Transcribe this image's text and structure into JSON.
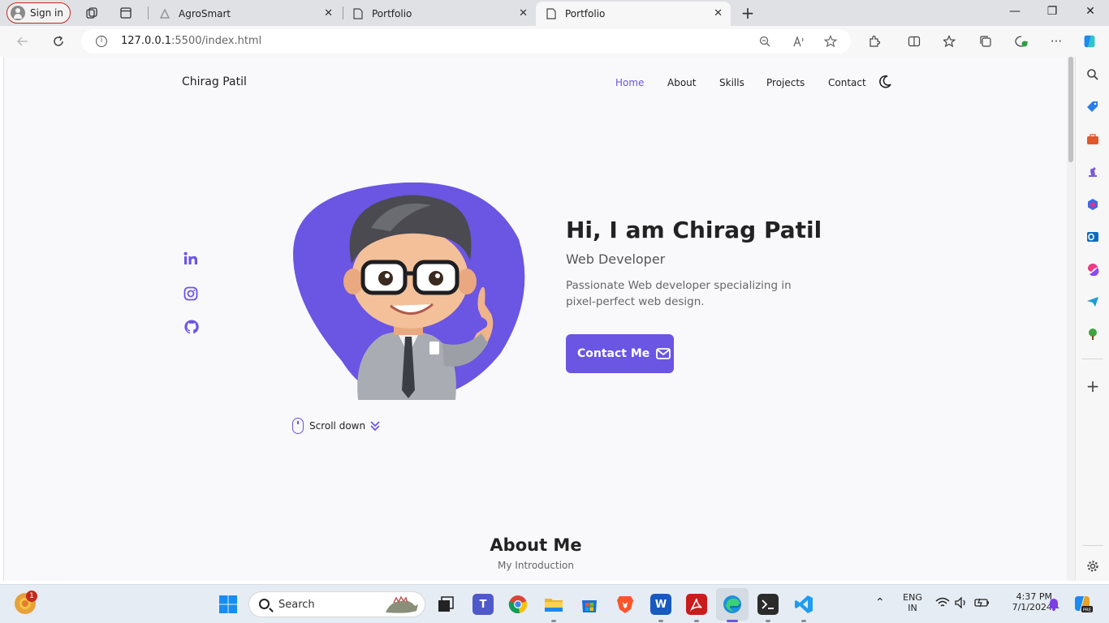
{
  "browser": {
    "signin_label": "Sign in",
    "tabs": [
      {
        "title": "AgroSmart"
      },
      {
        "title": "Portfolio"
      },
      {
        "title": "Portfolio"
      }
    ],
    "url_host": "127.0.0.1",
    "url_rest": ":5500/index.html"
  },
  "site": {
    "logo": "Chirag Patil",
    "nav": [
      "Home",
      "About",
      "Skills",
      "Projects",
      "Contact"
    ],
    "active_nav": "Home",
    "accent_color": "#6b55e3",
    "hero": {
      "title": "Hi, I am Chirag Patil",
      "subtitle": "Web Developer",
      "description": "Passionate Web developer specializing in pixel-perfect web design.",
      "button_label": "Contact Me",
      "scroll_label": "Scroll down"
    },
    "socials": [
      "linkedin-icon",
      "instagram-icon",
      "github-icon"
    ],
    "about": {
      "title": "About Me",
      "subtitle": "My Introduction"
    }
  },
  "taskbar": {
    "search_placeholder": "Search",
    "notification_count": "1",
    "language": "ENG",
    "region": "IN",
    "time": "4:37 PM",
    "date": "7/1/2024"
  }
}
